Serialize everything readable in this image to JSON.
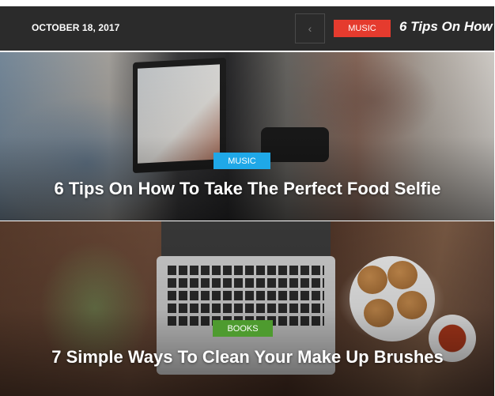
{
  "header": {
    "date": "OCTOBER 18, 2017",
    "prev_icon": "chevron-left-icon",
    "ticker_category": "MUSIC",
    "ticker_title": "6 Tips On How"
  },
  "posts": [
    {
      "category": "MUSIC",
      "category_color": "#1fa8e8",
      "title": "6 Tips On How To Take The Perfect Food Selfie"
    },
    {
      "category": "BOOKS",
      "category_color": "#4e9b2f",
      "title": "7 Simple Ways To Clean Your Make Up Brushes"
    }
  ],
  "colors": {
    "topbar": "#2b2b2b",
    "ticker_badge": "#e53b2e"
  }
}
